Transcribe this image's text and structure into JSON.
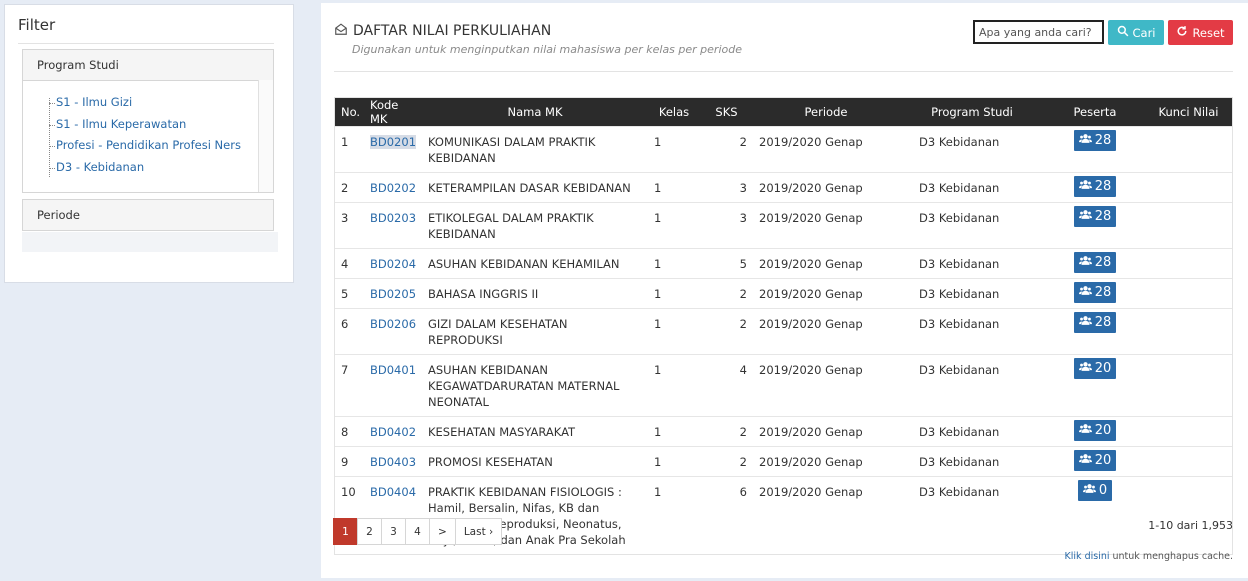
{
  "filter": {
    "title": "Filter",
    "program_studi_header": "Program Studi",
    "program_studi_items": [
      "S1 - Ilmu Gizi",
      "S1 - Ilmu Keperawatan",
      "Profesi - Pendidikan Profesi Ners",
      "D3 - Kebidanan"
    ],
    "periode_header": "Periode"
  },
  "main": {
    "title": "DAFTAR NILAI PERKULIAHAN",
    "subtitle": "Digunakan untuk menginputkan nilai mahasiswa per kelas per periode",
    "search_placeholder": "Apa yang anda cari?",
    "cari_label": "Cari",
    "reset_label": "Reset"
  },
  "table": {
    "headers": [
      "No.",
      "Kode MK",
      "Nama MK",
      "Kelas",
      "SKS",
      "Periode",
      "Program Studi",
      "Peserta",
      "Kunci Nilai"
    ],
    "rows": [
      {
        "no": "1",
        "kode": "BD0201",
        "nama": "KOMUNIKASI DALAM PRAKTIK KEBIDANAN",
        "kelas": "1",
        "sks": "2",
        "periode": "2019/2020 Genap",
        "prodi": "D3 Kebidanan",
        "peserta": "28"
      },
      {
        "no": "2",
        "kode": "BD0202",
        "nama": "KETERAMPILAN DASAR KEBIDANAN",
        "kelas": "1",
        "sks": "3",
        "periode": "2019/2020 Genap",
        "prodi": "D3 Kebidanan",
        "peserta": "28"
      },
      {
        "no": "3",
        "kode": "BD0203",
        "nama": "ETIKOLEGAL DALAM PRAKTIK KEBIDANAN",
        "kelas": "1",
        "sks": "3",
        "periode": "2019/2020 Genap",
        "prodi": "D3 Kebidanan",
        "peserta": "28"
      },
      {
        "no": "4",
        "kode": "BD0204",
        "nama": "ASUHAN KEBIDANAN KEHAMILAN",
        "kelas": "1",
        "sks": "5",
        "periode": "2019/2020 Genap",
        "prodi": "D3 Kebidanan",
        "peserta": "28"
      },
      {
        "no": "5",
        "kode": "BD0205",
        "nama": "BAHASA INGGRIS II",
        "kelas": "1",
        "sks": "2",
        "periode": "2019/2020 Genap",
        "prodi": "D3 Kebidanan",
        "peserta": "28"
      },
      {
        "no": "6",
        "kode": "BD0206",
        "nama": "GIZI DALAM KESEHATAN REPRODUKSI",
        "kelas": "1",
        "sks": "2",
        "periode": "2019/2020 Genap",
        "prodi": "D3 Kebidanan",
        "peserta": "28"
      },
      {
        "no": "7",
        "kode": "BD0401",
        "nama": "ASUHAN KEBIDANAN KEGAWATDARURATAN MATERNAL NEONATAL",
        "kelas": "1",
        "sks": "4",
        "periode": "2019/2020 Genap",
        "prodi": "D3 Kebidanan",
        "peserta": "20"
      },
      {
        "no": "8",
        "kode": "BD0402",
        "nama": "KESEHATAN MASYARAKAT",
        "kelas": "1",
        "sks": "2",
        "periode": "2019/2020 Genap",
        "prodi": "D3 Kebidanan",
        "peserta": "20"
      },
      {
        "no": "9",
        "kode": "BD0403",
        "nama": "PROMOSI KESEHATAN",
        "kelas": "1",
        "sks": "2",
        "periode": "2019/2020 Genap",
        "prodi": "D3 Kebidanan",
        "peserta": "20"
      },
      {
        "no": "10",
        "kode": "BD0404",
        "nama": "PRAKTIK KEBIDANAN FISIOLOGIS : Hamil, Bersalin, Nifas, KB dan Kesehatan Reproduksi, Neonatus, Bayi, Balita, dan Anak Pra Sekolah",
        "kelas": "1",
        "sks": "6",
        "periode": "2019/2020 Genap",
        "prodi": "D3 Kebidanan",
        "peserta": "0"
      }
    ]
  },
  "pagination": {
    "pages": [
      "1",
      "2",
      "3",
      "4",
      ">",
      "Last ›"
    ],
    "active": "1",
    "info": "1-10 dari 1,953"
  },
  "cache_note": {
    "link": "Klik disini",
    "text": " untuk menghapus cache."
  },
  "colors": {
    "accent_blue": "#2a6aa8",
    "cari": "#3fb8c7",
    "reset": "#e33b45",
    "active_page": "#c0392b",
    "table_header": "#2b2b2b"
  }
}
